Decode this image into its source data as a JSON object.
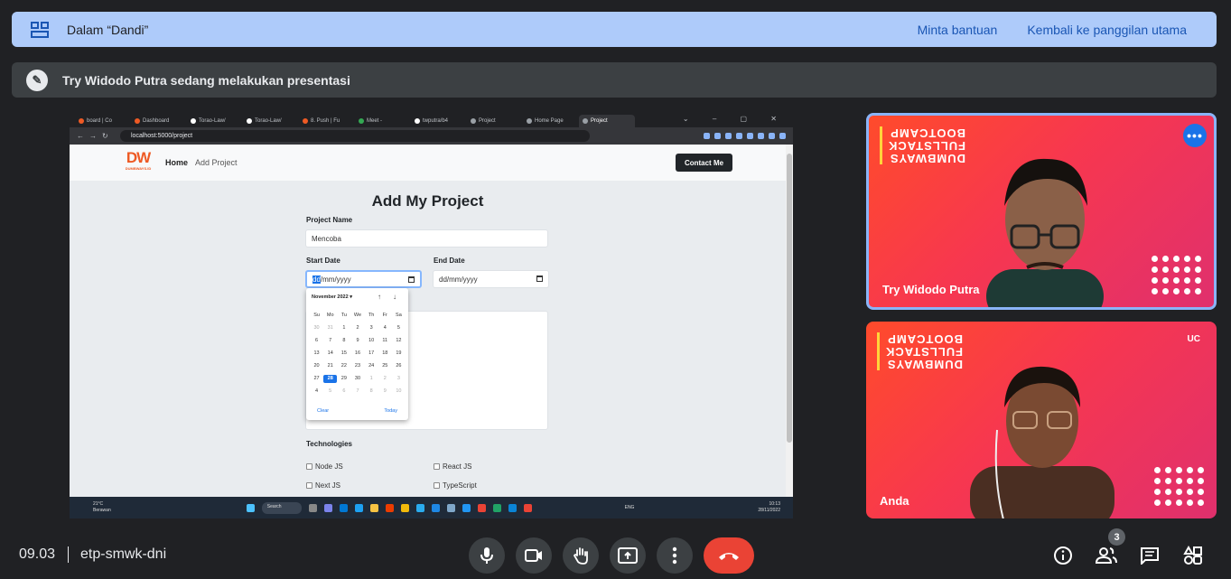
{
  "meeting": {
    "room_label": "Dalam “Dandi”",
    "help_link": "Minta bantuan",
    "back_link": "Kembali ke panggilan utama",
    "presenting_text": "Try Widodo Putra sedang melakukan presentasi",
    "time": "09.03",
    "code": "etp-smwk-dni",
    "participant_count": "3"
  },
  "shared_screen": {
    "tabs": [
      "board | Co",
      "Dashboard",
      "Torao-Law/",
      "Torao-Law/",
      "8. Push | Fu",
      "Meet -",
      "twputra/b4",
      "Project",
      "Home Page",
      "Project"
    ],
    "url": "localhost:5000/project",
    "site": {
      "logo_main": "DW",
      "logo_sub": "DUMBWAYS.ID",
      "nav_home": "Home",
      "nav_add": "Add Project",
      "contact": "Contact Me",
      "title": "Add My Project",
      "project_name_label": "Project Name",
      "project_name_value": "Mencoba",
      "start_label": "Start Date",
      "end_label": "End Date",
      "date_placeholder_hl": "dd",
      "date_placeholder_rest": "/mm/yyyy",
      "end_placeholder": "dd/mm/yyyy",
      "tech_label": "Technologies",
      "techs": [
        "Node JS",
        "React JS",
        "Next JS",
        "TypeScript"
      ]
    },
    "picker": {
      "month": "November 2022 ▾",
      "weekdays": [
        "Su",
        "Mo",
        "Tu",
        "We",
        "Th",
        "Fr",
        "Sa"
      ],
      "weeks": [
        [
          "30",
          "31",
          "1",
          "2",
          "3",
          "4",
          "5"
        ],
        [
          "6",
          "7",
          "8",
          "9",
          "10",
          "11",
          "12"
        ],
        [
          "13",
          "14",
          "15",
          "16",
          "17",
          "18",
          "19"
        ],
        [
          "20",
          "21",
          "22",
          "23",
          "24",
          "25",
          "26"
        ],
        [
          "27",
          "28",
          "29",
          "30",
          "1",
          "2",
          "3"
        ],
        [
          "4",
          "5",
          "6",
          "7",
          "8",
          "9",
          "10"
        ]
      ],
      "selected": "28",
      "clear": "Clear",
      "today": "Today"
    },
    "taskbar": {
      "temp": "21°C",
      "weather": "Berawan",
      "search": "Search",
      "lang": "ENG",
      "time": "10:13",
      "date": "28/11/2022"
    }
  },
  "tiles": [
    {
      "brand": [
        "BOOTCAMP",
        "FULLSTACK",
        "DUMBWAYS"
      ],
      "name": "Try Widodo Putra"
    },
    {
      "brand": [
        "BOOTCAMP",
        "FULLSTACK",
        "DUMBWAYS"
      ],
      "name": "Anda",
      "logo": "UC"
    }
  ],
  "colors": {
    "accent": "#1a73e8",
    "end_call": "#ea4335",
    "banner": "#aecbfa",
    "brand": "#ee5a24"
  },
  "icons": [
    "breakout-room-icon",
    "presenter-icon",
    "mic-icon",
    "camera-icon",
    "raise-hand-icon",
    "present-screen-icon",
    "more-options-icon",
    "end-call-icon",
    "info-icon",
    "people-icon",
    "chat-icon",
    "activities-icon"
  ]
}
